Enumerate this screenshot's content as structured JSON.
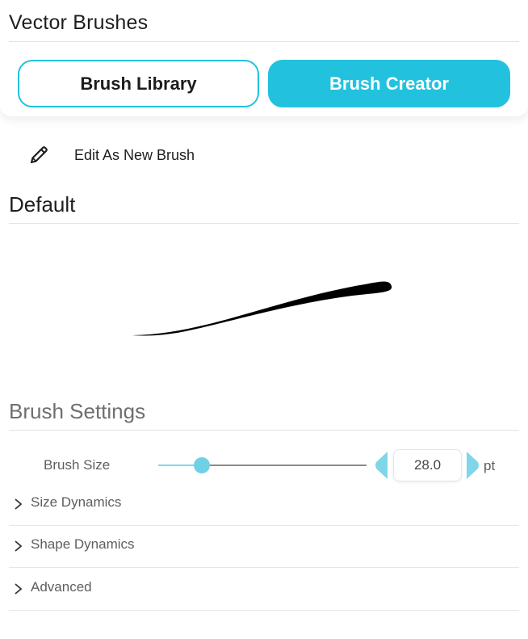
{
  "panel": {
    "title": "Vector Brushes"
  },
  "tabs": [
    {
      "label": "Brush Library",
      "active": false
    },
    {
      "label": "Brush Creator",
      "active": true
    }
  ],
  "edit_action": {
    "label": "Edit As New Brush",
    "icon": "pencil-icon"
  },
  "brush": {
    "name": "Default"
  },
  "settings": {
    "title": "Brush Settings",
    "brush_size": {
      "label": "Brush Size",
      "value": "28.0",
      "unit": "pt",
      "slider_fraction": 0.21
    },
    "sections": [
      {
        "label": "Size Dynamics",
        "expanded": false
      },
      {
        "label": "Shape Dynamics",
        "expanded": false
      },
      {
        "label": "Advanced",
        "expanded": false
      }
    ]
  },
  "colors": {
    "accent": "#22c2de",
    "slider_thumb": "#6fd1e6"
  }
}
